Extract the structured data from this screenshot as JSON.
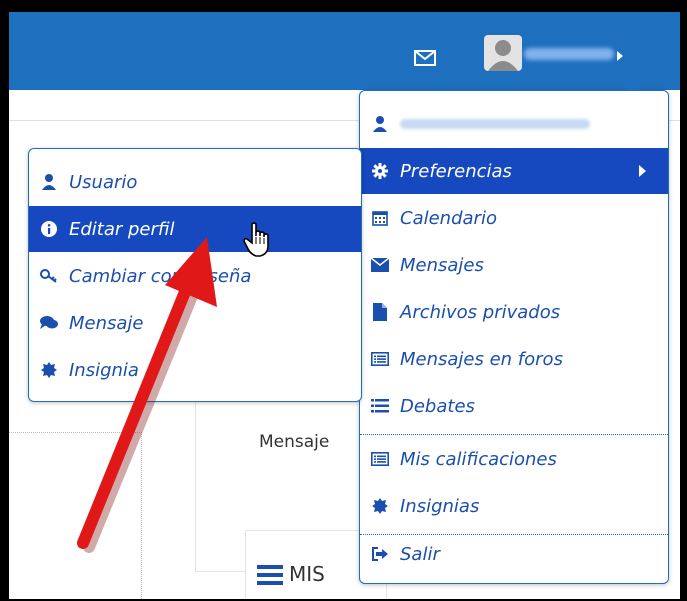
{
  "topbar": {
    "icons": [
      "envelope-icon",
      "avatar-icon",
      "caret-right-icon"
    ]
  },
  "user_menu": {
    "items": [
      {
        "label": "Preferencias",
        "icon": "gear-icon"
      },
      {
        "label": "Calendario",
        "icon": "calendar-icon"
      },
      {
        "label": "Mensajes",
        "icon": "envelope-icon"
      },
      {
        "label": "Archivos privados",
        "icon": "file-icon"
      },
      {
        "label": "Mensajes en foros",
        "icon": "list-icon"
      },
      {
        "label": "Debates",
        "icon": "bars-icon"
      },
      {
        "label": "Mis calificaciones",
        "icon": "list-icon"
      },
      {
        "label": "Insignias",
        "icon": "badge-icon"
      },
      {
        "label": "Salir",
        "icon": "sign-out-icon"
      }
    ]
  },
  "submenu": {
    "items": [
      {
        "label": "Usuario",
        "icon": "user-icon"
      },
      {
        "label": "Editar perfil",
        "icon": "info-icon"
      },
      {
        "label": "Cambiar contraseña",
        "icon": "key-icon"
      },
      {
        "label": "Mensaje",
        "icon": "comments-icon"
      },
      {
        "label": "Insignia",
        "icon": "badge-icon"
      }
    ]
  },
  "background": {
    "mensaje_text": "Mensaje",
    "mis_text": "MIS"
  },
  "colors": {
    "topbar": "#1f6fbf",
    "active": "#1649c0",
    "link": "#1b4fae",
    "arrow": "#e01818"
  }
}
